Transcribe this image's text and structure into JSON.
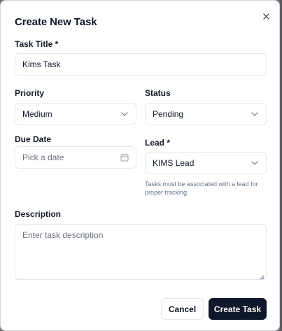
{
  "dialog": {
    "title": "Create New Task",
    "close_icon": "close-icon"
  },
  "fields": {
    "task_title": {
      "label": "Task Title *",
      "value": "Kims Task"
    },
    "priority": {
      "label": "Priority",
      "value": "Medium"
    },
    "status": {
      "label": "Status",
      "value": "Pending"
    },
    "due_date": {
      "label": "Due Date",
      "placeholder": "Pick a date",
      "icon": "calendar-icon"
    },
    "lead": {
      "label": "Lead *",
      "value": "KIMS Lead",
      "hint": "Tasks must be associated with a lead for proper tracking"
    },
    "description": {
      "label": "Description",
      "placeholder": "Enter task description"
    }
  },
  "actions": {
    "cancel_label": "Cancel",
    "create_label": "Create Task"
  },
  "colors": {
    "primary": "#0f172a",
    "border": "#e2e8f0",
    "muted_text": "#64748b",
    "overlay": "#6f6f73"
  }
}
